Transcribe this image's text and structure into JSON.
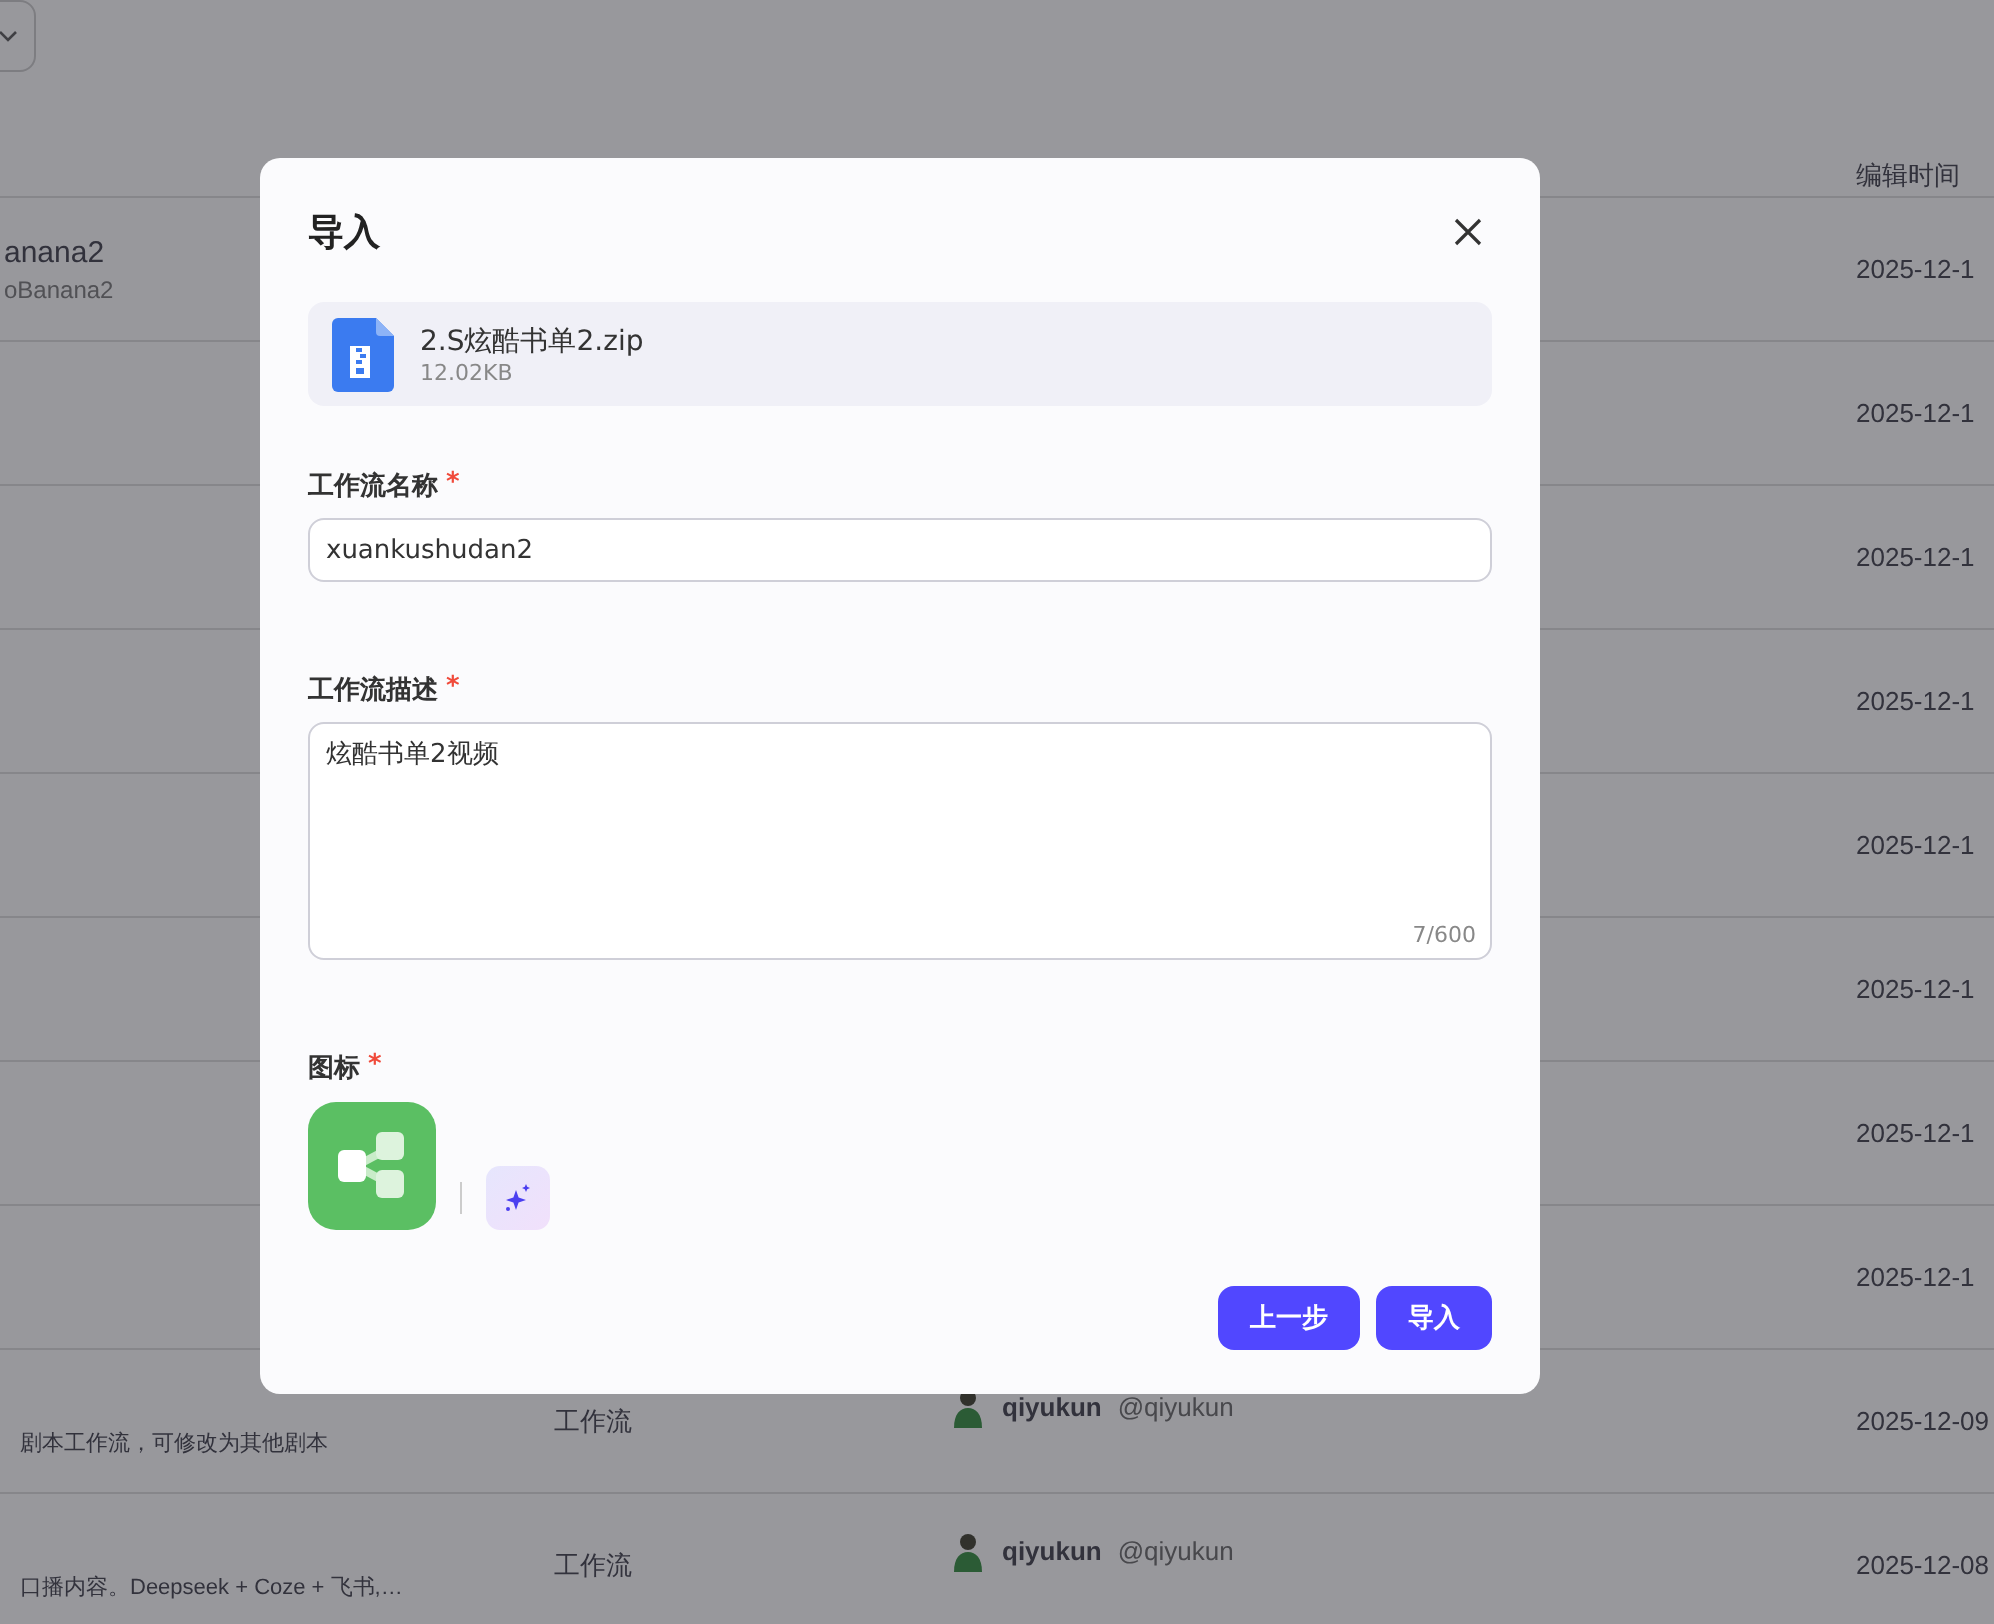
{
  "table": {
    "columns": [
      {
        "label": "编辑时间"
      }
    ],
    "rows": [
      {
        "name": "anana2",
        "subtitle": "oBanana2",
        "date": "2025-12-1"
      },
      {
        "date": "2025-12-1"
      },
      {
        "date": "2025-12-1"
      },
      {
        "date": "2025-12-1"
      },
      {
        "date": "2025-12-1"
      },
      {
        "date": "2025-12-1"
      },
      {
        "date": "2025-12-1"
      },
      {
        "date": "2025-12-1"
      },
      {
        "subtitle": "剧本工作流，可修改为其他剧本",
        "type": "工作流",
        "creator": "qiyukun",
        "handle": "@qiyukun",
        "date": "2025-12-09"
      },
      {
        "subtitle": "口播内容。Deepseek + Coze + 飞书,…",
        "type": "工作流",
        "creator": "qiyukun",
        "handle": "@qiyukun",
        "date": "2025-12-08"
      }
    ]
  },
  "dialog": {
    "title": "导入",
    "file": {
      "name": "2.S炫酷书单2.zip",
      "size": "12.02KB"
    },
    "name_field": {
      "label": "工作流名称",
      "required_mark": "*",
      "value": "xuankushudan2"
    },
    "description_field": {
      "label": "工作流描述",
      "required_mark": "*",
      "value": "炫酷书单2视频",
      "counter": "7/600"
    },
    "icon_field": {
      "label": "图标",
      "required_mark": "*"
    },
    "buttons": [
      {
        "label": "上一步"
      },
      {
        "label": "导入"
      }
    ]
  }
}
